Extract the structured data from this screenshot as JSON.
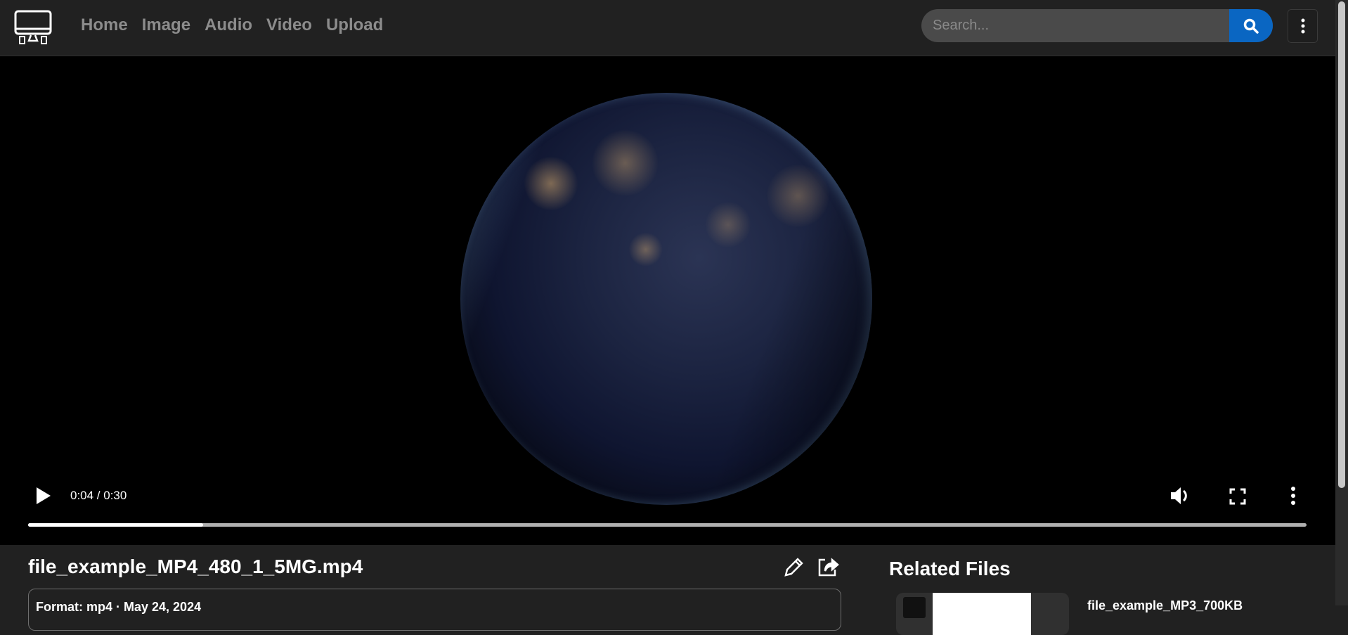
{
  "header": {
    "nav": [
      "Home",
      "Image",
      "Audio",
      "Video",
      "Upload"
    ],
    "search": {
      "placeholder": "Search...",
      "value": ""
    },
    "colors": {
      "accent": "#0a66c2",
      "background": "#212121",
      "nav_text": "#8c8c8c"
    }
  },
  "player": {
    "time": "0:04 / 0:30",
    "progress_fraction": 0.137,
    "icons": [
      "play-icon",
      "volume-icon",
      "fullscreen-icon",
      "more-vert-icon"
    ]
  },
  "file": {
    "title": "file_example_MP4_480_1_5MG.mp4",
    "meta": "Format: mp4 · May 24, 2024"
  },
  "related": {
    "title": "Related Files",
    "items": [
      {
        "name": "file_example_MP3_700KB"
      }
    ]
  }
}
